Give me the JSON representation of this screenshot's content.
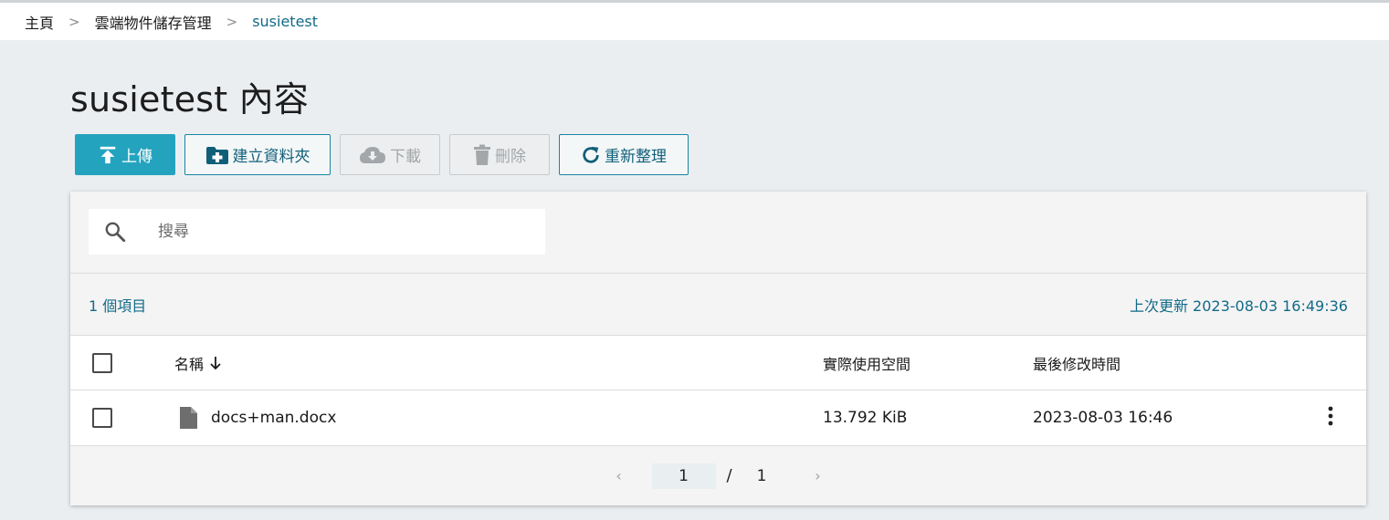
{
  "breadcrumb": {
    "items": [
      "主頁",
      "雲端物件儲存管理",
      "susietest"
    ],
    "separator": ">"
  },
  "page": {
    "title": "susietest 內容"
  },
  "toolbar": {
    "upload": "上傳",
    "create_folder": "建立資料夾",
    "download": "下載",
    "delete": "刪除",
    "refresh": "重新整理"
  },
  "search": {
    "placeholder": "搜尋"
  },
  "info": {
    "count": "1 個項目",
    "last_updated": "上次更新 2023-08-03 16:49:36"
  },
  "table": {
    "headers": {
      "name": "名稱",
      "size": "實際使用空間",
      "modified": "最後修改時間"
    },
    "rows": [
      {
        "name": "docs+man.docx",
        "size": "13.792 KiB",
        "modified": "2023-08-03 16:46"
      }
    ]
  },
  "pagination": {
    "current": "1",
    "separator": "/",
    "total": "1",
    "prev": "‹",
    "next": "›"
  },
  "colors": {
    "accent": "#24a3bf",
    "link": "#126a87",
    "background": "#ebeef1"
  }
}
